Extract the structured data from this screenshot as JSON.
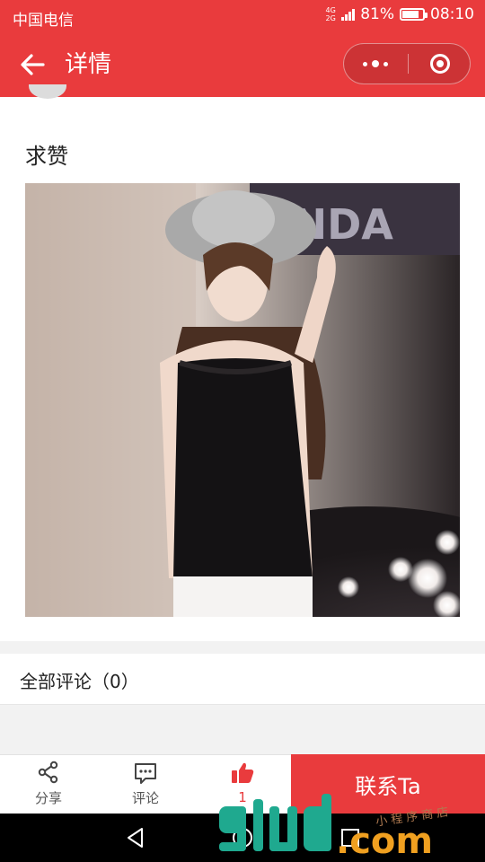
{
  "status_bar": {
    "carrier": "中国电信",
    "network_type": "4G\n2G",
    "battery_percent": "81%",
    "battery_level": 0.81,
    "time": "08:10"
  },
  "nav": {
    "title": "详情",
    "back_icon": "arrow-left-icon",
    "more_icon": "more-dots-icon",
    "close_icon": "target-circle-icon"
  },
  "post": {
    "text": "求赞",
    "image_alt": "photo"
  },
  "comments": {
    "title": "全部评论（0）"
  },
  "actions": {
    "share_label": "分享",
    "comment_label": "评论",
    "like_count": "1",
    "contact_label": "联系Ta"
  },
  "colors": {
    "brand_red": "#e93b3d"
  }
}
